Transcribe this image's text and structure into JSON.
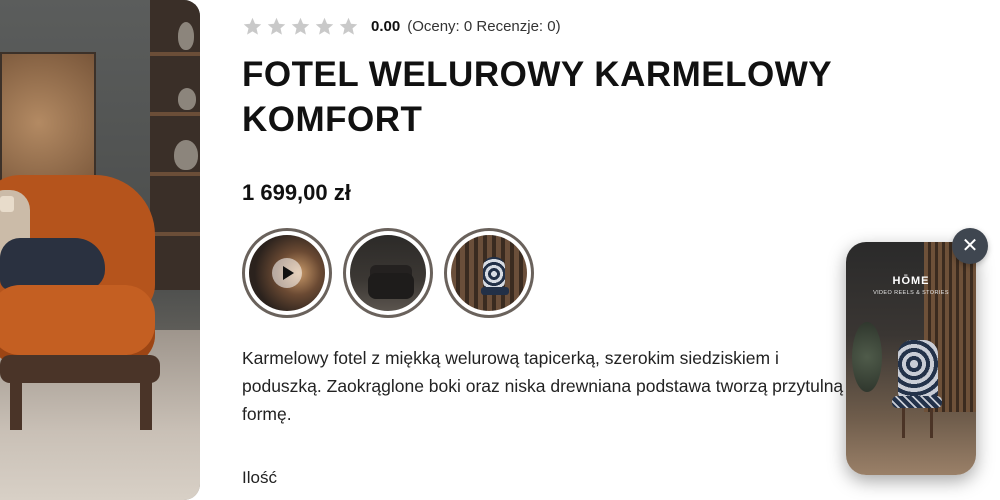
{
  "product": {
    "rating": {
      "stars_filled": 0,
      "stars_total": 5,
      "value": "0.00",
      "meta": "(Oceny: 0 Recenzje: 0)"
    },
    "title": "FOTEL WELUROWY KARMELOWY KOMFORT",
    "price": "1 699,00 zł",
    "gallery_thumbs": [
      {
        "kind": "video",
        "icon": "play-icon"
      },
      {
        "kind": "image"
      },
      {
        "kind": "image"
      }
    ],
    "description": "Karmelowy fotel z miękką welurową tapicerką, szerokim siedziskiem i poduszką. Zaokrąglone boki oraz niska drewniana podstawa tworzą przytulną formę.",
    "quantity_label": "Ilość"
  },
  "video_popup": {
    "brand": "HŌME",
    "tagline": "VIDEO REELS & STORIES",
    "close_icon": "close-icon"
  },
  "colors": {
    "star_empty": "#c9c9c9",
    "thumb_ring": "#6a625c",
    "close_button_bg": "#3f4650"
  }
}
